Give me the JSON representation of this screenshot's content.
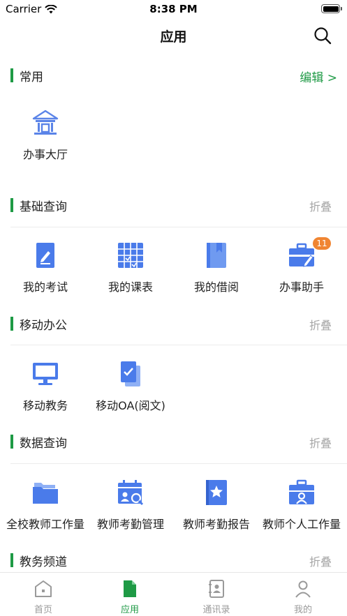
{
  "status_bar": {
    "carrier": "Carrier",
    "time": "8:38 PM"
  },
  "nav": {
    "title": "应用"
  },
  "sections": {
    "common": {
      "title": "常用",
      "action": "编辑 >"
    },
    "basic": {
      "title": "基础查询",
      "action": "折叠"
    },
    "mobile": {
      "title": "移动办公",
      "action": "折叠"
    },
    "data": {
      "title": "数据查询",
      "action": "折叠"
    },
    "academic": {
      "title": "教务频道",
      "action": "折叠"
    }
  },
  "apps": {
    "service_hall": "办事大厅",
    "my_exam": "我的考试",
    "my_schedule": "我的课表",
    "my_borrow": "我的借阅",
    "assistant": "办事助手",
    "assistant_badge": "11",
    "mobile_academic": "移动教务",
    "mobile_oa": "移动OA(阅文)",
    "all_teacher_work": "全校教师工作量",
    "teacher_attendance_mgmt": "教师考勤管理",
    "teacher_attendance_report": "教师考勤报告",
    "teacher_personal_work": "教师个人工作量"
  },
  "tabs": {
    "home": "首页",
    "apps": "应用",
    "contacts": "通讯录",
    "mine": "我的"
  },
  "colors": {
    "accent": "#1e9a45",
    "icon_blue": "#4a7bea",
    "badge": "#f08532"
  }
}
